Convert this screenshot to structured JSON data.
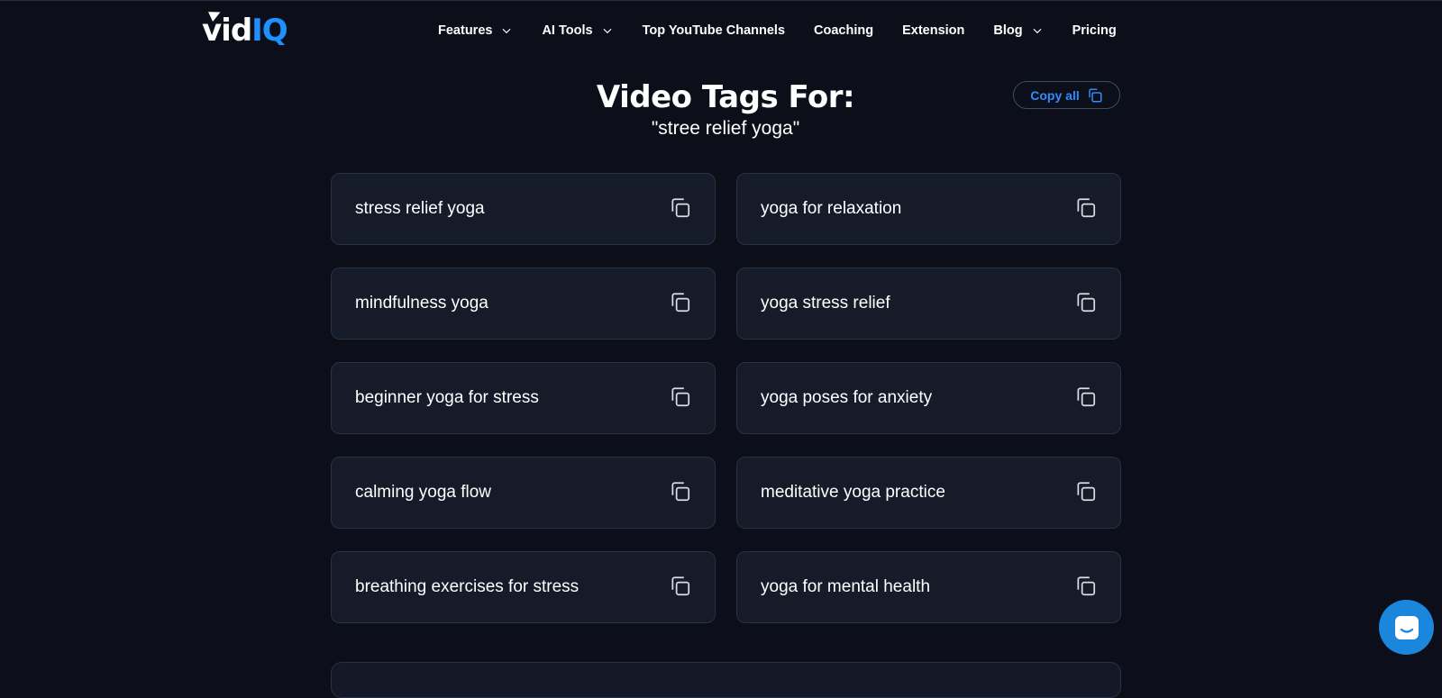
{
  "brand": {
    "logo_vid": "vid",
    "logo_iq": "IQ"
  },
  "nav": [
    {
      "label": "Features",
      "has_dropdown": true
    },
    {
      "label": "AI Tools",
      "has_dropdown": true
    },
    {
      "label": "Top YouTube Channels",
      "has_dropdown": false
    },
    {
      "label": "Coaching",
      "has_dropdown": false
    },
    {
      "label": "Extension",
      "has_dropdown": false
    },
    {
      "label": "Blog",
      "has_dropdown": true
    },
    {
      "label": "Pricing",
      "has_dropdown": false
    }
  ],
  "main": {
    "title": "Video Tags For:",
    "query": "\"stree relief yoga\"",
    "copy_all_label": "Copy all",
    "tags": [
      "stress relief yoga",
      "yoga for relaxation",
      "mindfulness yoga",
      "yoga stress relief",
      "beginner yoga for stress",
      "yoga poses for anxiety",
      "calming yoga flow",
      "meditative yoga practice",
      "breathing exercises for stress",
      "yoga for mental health"
    ]
  },
  "icons": {
    "copy": "copy-icon",
    "chevron": "chevron-down-icon",
    "chat": "chat-icon"
  },
  "colors": {
    "background": "#0c0f1a",
    "card": "#161b2a",
    "accent": "#1e90ff",
    "chat": "#1b87dc"
  }
}
